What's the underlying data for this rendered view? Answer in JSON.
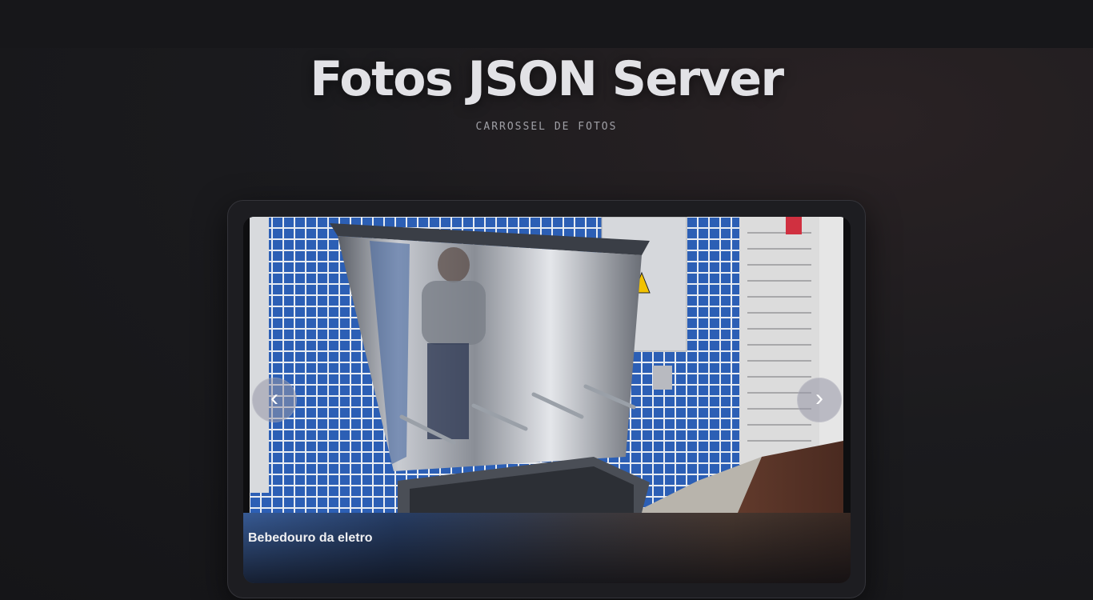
{
  "header": {
    "title": "Fotos JSON Server",
    "subtitle": "CARROSSEL DE FOTOS"
  },
  "carousel": {
    "current_slide": {
      "caption": "Bebedouro da eletro"
    },
    "prev_icon": "‹",
    "next_icon": "›"
  },
  "colors": {
    "tile_blue": "#2a5fb8",
    "background": "#1b1b1e"
  }
}
